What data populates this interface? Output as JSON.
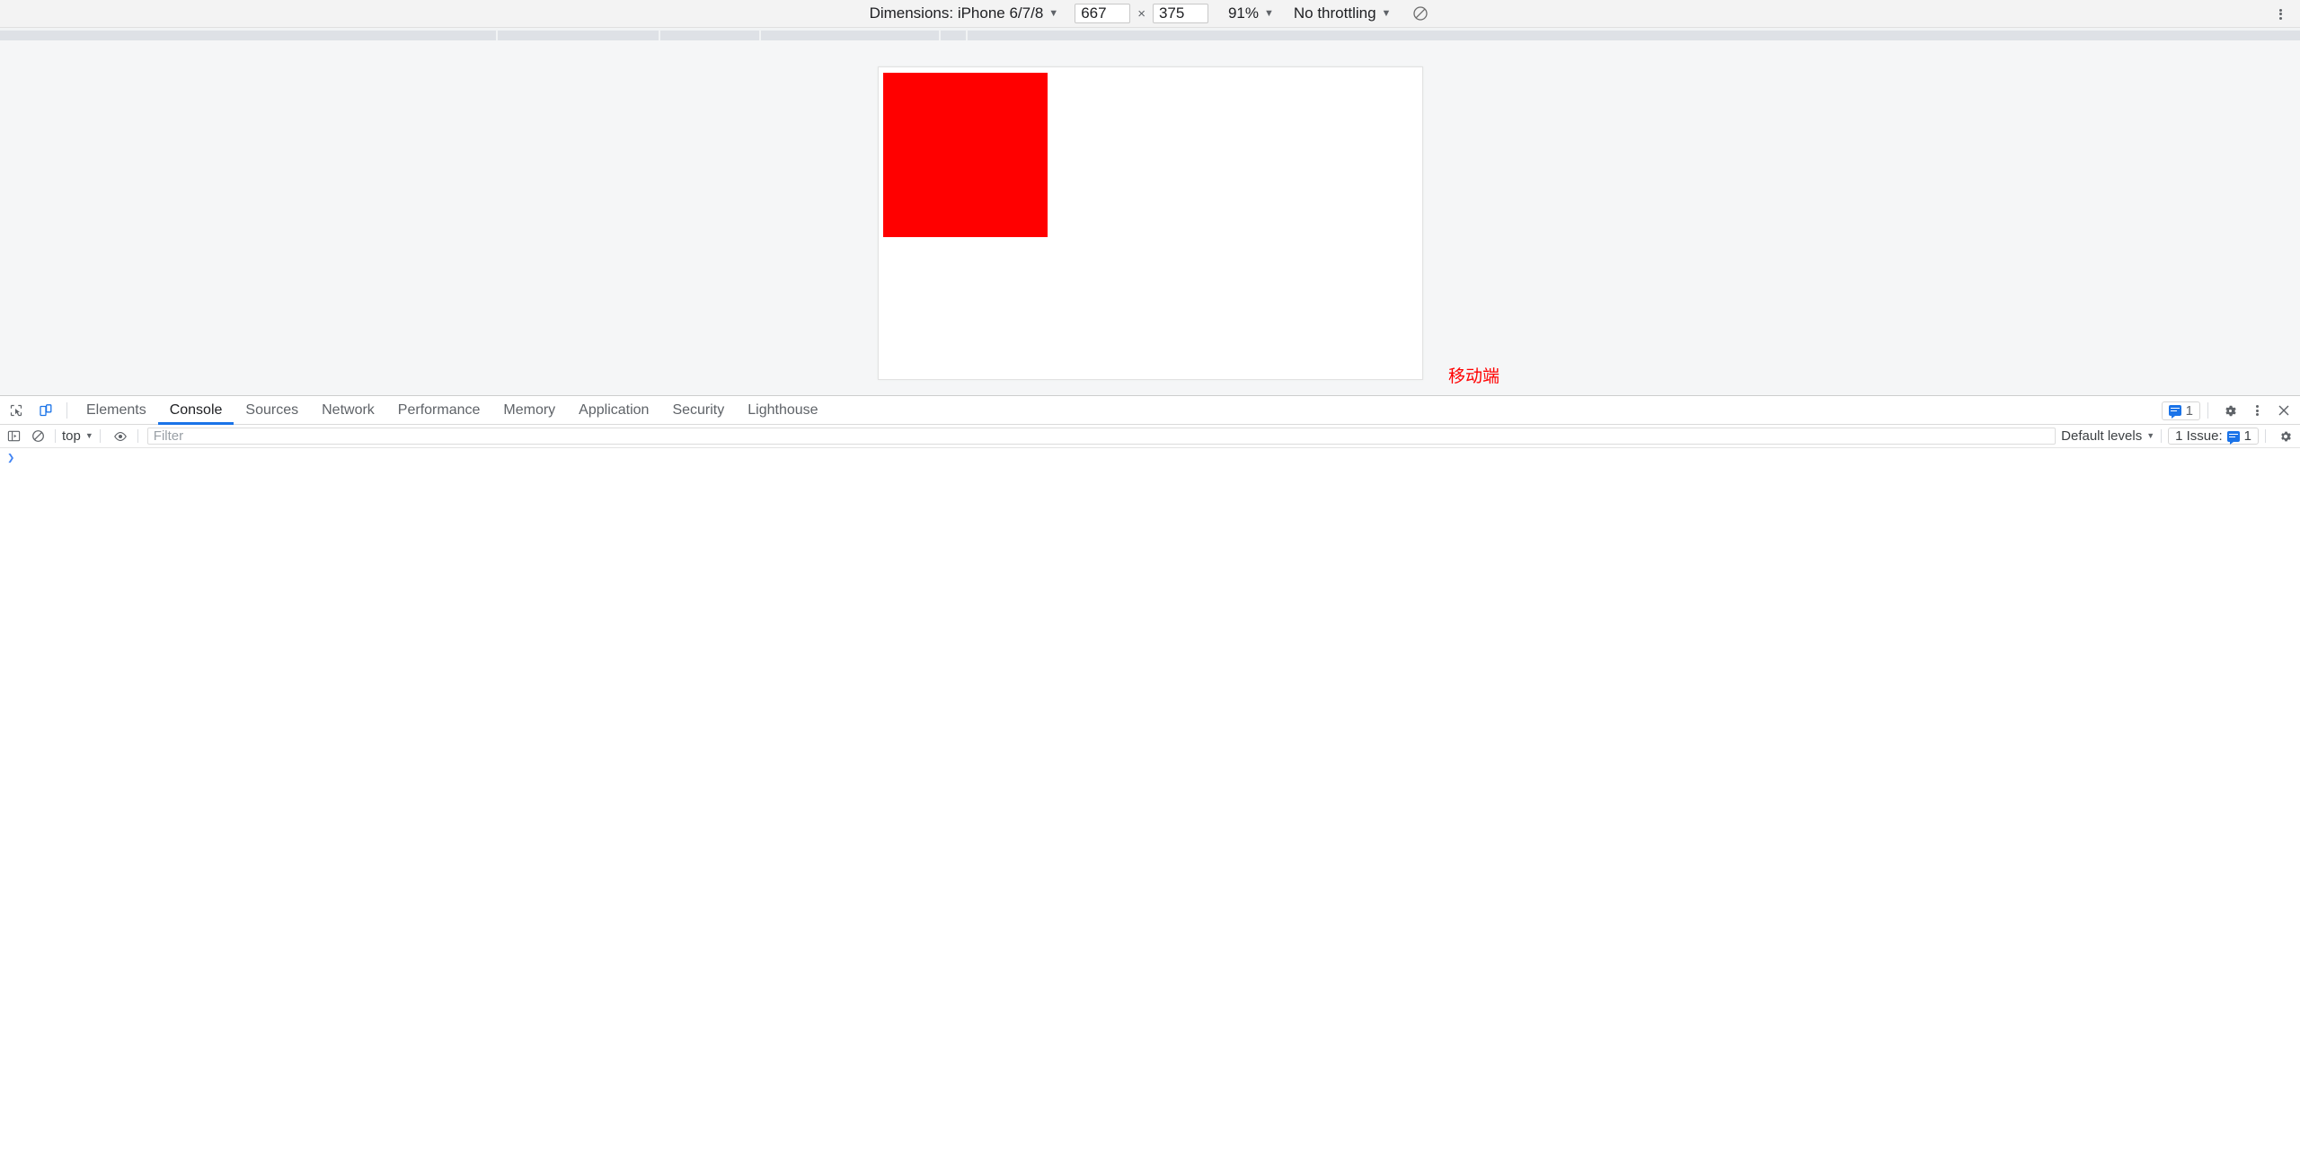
{
  "device_toolbar": {
    "dimensions_label": "Dimensions: iPhone 6/7/8",
    "dimensions_caret": "▼",
    "width_value": "667",
    "height_value": "375",
    "times_symbol": "×",
    "zoom_label": "91%",
    "zoom_caret": "▼",
    "throttling_label": "No throttling",
    "throttling_caret": "▼",
    "rotate_icon": "rotate-icon",
    "more_options_icon": "kebab-menu-icon"
  },
  "viewport": {
    "red_box_color": "#ff0000",
    "annotation_text": "移动端",
    "annotation_color": "#ff0000"
  },
  "devtools": {
    "inspect_icon": "inspect-element-icon",
    "device_toggle_icon": "device-toolbar-icon",
    "tabs": [
      {
        "label": "Elements",
        "active": false
      },
      {
        "label": "Console",
        "active": true
      },
      {
        "label": "Sources",
        "active": false
      },
      {
        "label": "Network",
        "active": false
      },
      {
        "label": "Performance",
        "active": false
      },
      {
        "label": "Memory",
        "active": false
      },
      {
        "label": "Application",
        "active": false
      },
      {
        "label": "Security",
        "active": false
      },
      {
        "label": "Lighthouse",
        "active": false
      }
    ],
    "active_tab_underline_color": "#1a73e8",
    "right_controls": {
      "message_count": "1",
      "message_badge_icon": "message-badge-icon",
      "settings_icon": "gear-icon",
      "more_icon": "kebab-menu-icon",
      "close_icon": "close-icon"
    }
  },
  "console_toolbar": {
    "sidebar_toggle_icon": "console-sidebar-icon",
    "clear_icon": "clear-console-icon",
    "context_label": "top",
    "context_caret": "▼",
    "eye_icon": "live-expression-icon",
    "filter_placeholder": "Filter",
    "filter_value": "",
    "levels_label": "Default levels",
    "levels_caret": "▼",
    "issues_label": "1 Issue:",
    "issues_count": "1",
    "issues_badge_icon": "message-badge-icon",
    "settings_icon": "gear-icon"
  },
  "console": {
    "prompt_symbol": "❯",
    "input_value": ""
  }
}
